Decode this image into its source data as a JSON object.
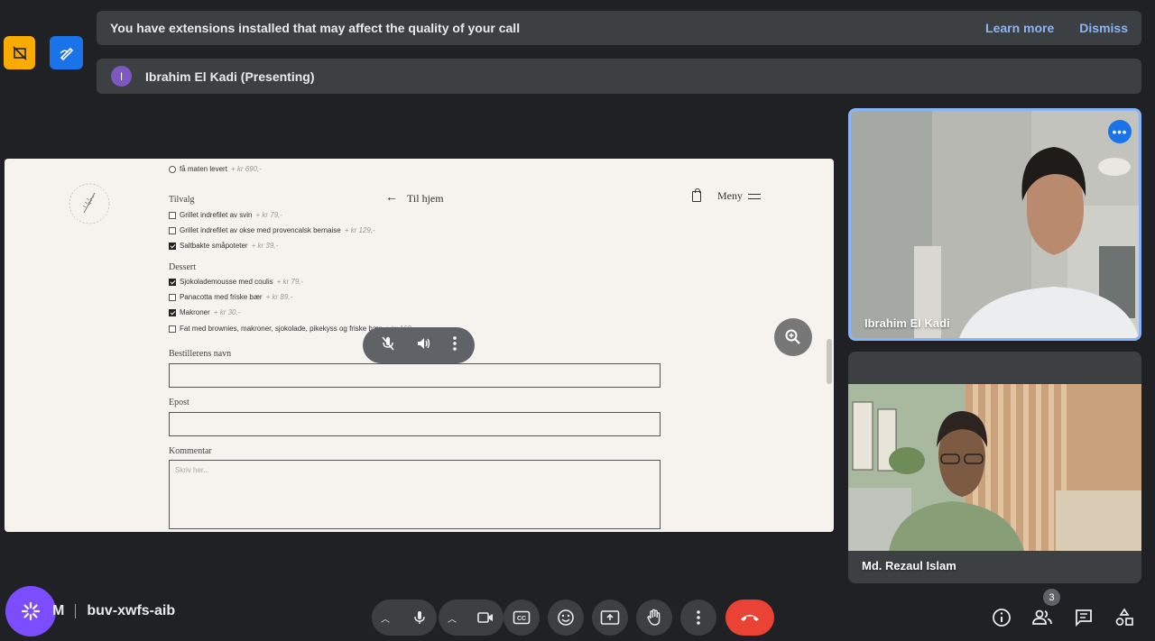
{
  "banner": {
    "message": "You have extensions installed that may affect the quality of your call",
    "learn_more": "Learn more",
    "dismiss": "Dismiss"
  },
  "presenting": {
    "avatar_letter": "I",
    "label": "Ibrahim El Kadi (Presenting)"
  },
  "shared_page": {
    "nav_home": "Til hjem",
    "nav_menu": "Meny",
    "options_top": [
      {
        "label": "få maten levert",
        "price": "+ kr 690,-",
        "checked": false
      }
    ],
    "tillegg_heading": "Tilvalg",
    "tillegg": [
      {
        "label": "Grillet indrefilet av svin",
        "price": "+ kr 79,-",
        "checked": false
      },
      {
        "label": "Grillet indrefilet av okse med provencalsk bernaise",
        "price": "+ kr 129,-",
        "checked": false
      },
      {
        "label": "Saltbakte småpoteter",
        "price": "+ kr 39,-",
        "checked": true
      }
    ],
    "dessert_heading": "Dessert",
    "dessert": [
      {
        "label": "Sjokolademousse med coulis",
        "price": "+ kr 79,-",
        "checked": true
      },
      {
        "label": "Panacotta med friske bær",
        "price": "+ kr 89,-",
        "checked": false
      },
      {
        "label": "Makroner",
        "price": "+ kr 30,-",
        "checked": true
      },
      {
        "label": "Fat med brownies, makroner, sjokolade, pikekyss og friske bær",
        "price": "+ kr 160,-",
        "checked": false
      }
    ],
    "name_label": "Bestillerens navn",
    "email_label": "Epost",
    "comment_label": "Kommentar",
    "comment_placeholder": "Skriv her..."
  },
  "participants": [
    {
      "name": "Ibrahim El Kadi"
    },
    {
      "name": "Md. Rezaul Islam"
    }
  ],
  "bottom": {
    "time_suffix": "M",
    "meeting_code": "buv-xwfs-aib",
    "people_count": "3"
  },
  "colors": {
    "accent": "#8ab4f8",
    "leave": "#ea4335",
    "ai": "#7c4dff"
  }
}
